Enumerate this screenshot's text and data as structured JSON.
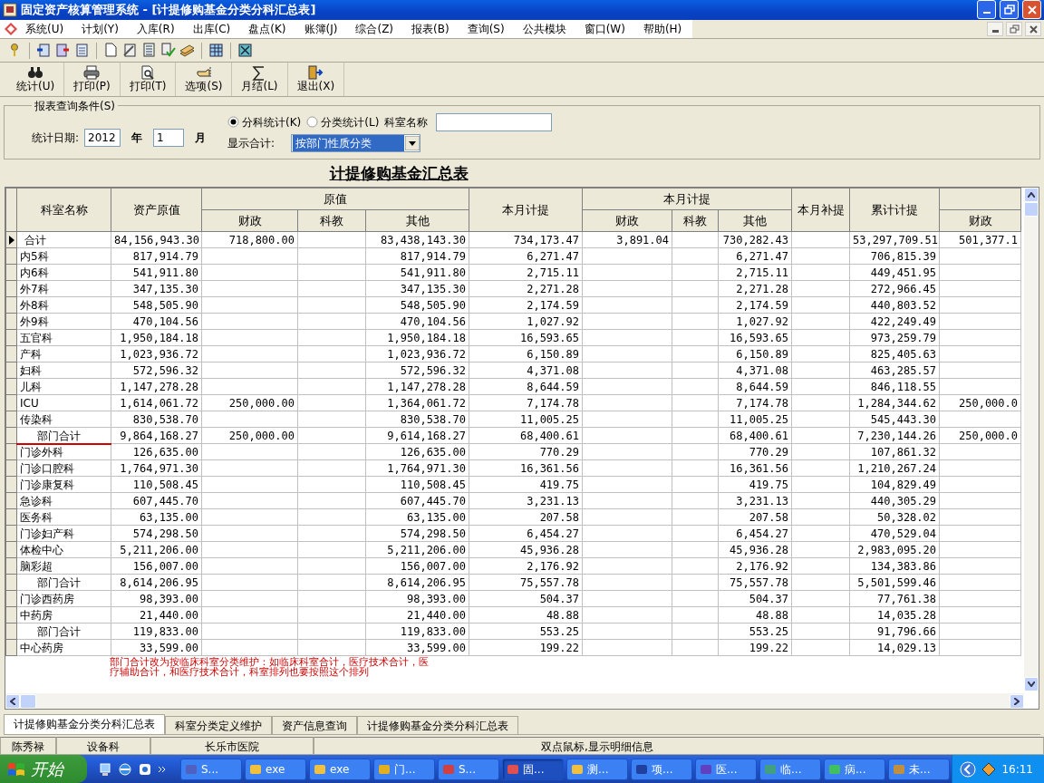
{
  "window": {
    "title": "固定资产核算管理系统 - [计提修购基金分类分科汇总表]"
  },
  "menu": [
    {
      "label": "系统(U)"
    },
    {
      "label": "计划(Y)"
    },
    {
      "label": "入库(R)"
    },
    {
      "label": "出库(C)"
    },
    {
      "label": "盘点(K)"
    },
    {
      "label": "账簿(J)"
    },
    {
      "label": "综合(Z)"
    },
    {
      "label": "报表(B)"
    },
    {
      "label": "查询(S)"
    },
    {
      "label": "公共模块"
    },
    {
      "label": "窗口(W)"
    },
    {
      "label": "帮助(H)"
    }
  ],
  "toolbar_buttons": [
    {
      "label": "统计(U)",
      "kind": "binoculars"
    },
    {
      "label": "打印(P)",
      "kind": "printer"
    },
    {
      "label": "打印(T)",
      "kind": "preview"
    },
    {
      "label": "选项(S)",
      "kind": "pointer"
    },
    {
      "label": "月结(L)",
      "kind": "sigma"
    },
    {
      "label": "退出(X)",
      "kind": "exit"
    }
  ],
  "query": {
    "legend": "报表查询条件(S)",
    "date_label": "统计日期:",
    "year": "2012",
    "year_unit": "年",
    "month": "1",
    "month_unit": "月",
    "radios": [
      {
        "label": "分科统计(K)",
        "selected": true
      },
      {
        "label": "分类统计(L)",
        "selected": false
      }
    ],
    "dept_label": "科室名称",
    "total_label": "显示合计:",
    "total_value": "按部门性质分类"
  },
  "report_title": "计提修购基金汇总表",
  "columns": [
    {
      "label": "科室名称"
    },
    {
      "label": "资产原值"
    },
    {
      "label": "原值",
      "children": [
        {
          "label": "财政"
        },
        {
          "label": "科教"
        },
        {
          "label": "其他"
        }
      ]
    },
    {
      "label": "本月计提"
    },
    {
      "label": "本月计提",
      "children": [
        {
          "label": "财政"
        },
        {
          "label": "科教"
        },
        {
          "label": "其他"
        }
      ]
    },
    {
      "label": "本月补提"
    },
    {
      "label": "累计计提"
    },
    {
      "children": [
        {
          "label": "财政"
        }
      ]
    }
  ],
  "rows": [
    {
      "kind": "total",
      "selected": true,
      "marked": false,
      "cells": [
        "合计",
        "84,156,943.30",
        "718,800.00",
        null,
        "83,438,143.30",
        "734,173.47",
        "3,891.04",
        null,
        "730,282.43",
        null,
        "53,297,709.51",
        "501,377.1"
      ]
    },
    {
      "kind": "dept",
      "selected": false,
      "marked": false,
      "cells": [
        "内5科",
        "817,914.79",
        null,
        null,
        "817,914.79",
        "6,271.47",
        null,
        null,
        "6,271.47",
        null,
        "706,815.39",
        null
      ]
    },
    {
      "kind": "dept",
      "selected": false,
      "marked": false,
      "cells": [
        "内6科",
        "541,911.80",
        null,
        null,
        "541,911.80",
        "2,715.11",
        null,
        null,
        "2,715.11",
        null,
        "449,451.95",
        null
      ]
    },
    {
      "kind": "dept",
      "selected": false,
      "marked": false,
      "cells": [
        "外7科",
        "347,135.30",
        null,
        null,
        "347,135.30",
        "2,271.28",
        null,
        null,
        "2,271.28",
        null,
        "272,966.45",
        null
      ]
    },
    {
      "kind": "dept",
      "selected": false,
      "marked": false,
      "cells": [
        "外8科",
        "548,505.90",
        null,
        null,
        "548,505.90",
        "2,174.59",
        null,
        null,
        "2,174.59",
        null,
        "440,803.52",
        null
      ]
    },
    {
      "kind": "dept",
      "selected": false,
      "marked": false,
      "cells": [
        "外9科",
        "470,104.56",
        null,
        null,
        "470,104.56",
        "1,027.92",
        null,
        null,
        "1,027.92",
        null,
        "422,249.49",
        null
      ]
    },
    {
      "kind": "dept",
      "selected": false,
      "marked": false,
      "cells": [
        "五官科",
        "1,950,184.18",
        null,
        null,
        "1,950,184.18",
        "16,593.65",
        null,
        null,
        "16,593.65",
        null,
        "973,259.79",
        null
      ]
    },
    {
      "kind": "dept",
      "selected": false,
      "marked": false,
      "cells": [
        "产科",
        "1,023,936.72",
        null,
        null,
        "1,023,936.72",
        "6,150.89",
        null,
        null,
        "6,150.89",
        null,
        "825,405.63",
        null
      ]
    },
    {
      "kind": "dept",
      "selected": false,
      "marked": false,
      "cells": [
        "妇科",
        "572,596.32",
        null,
        null,
        "572,596.32",
        "4,371.08",
        null,
        null,
        "4,371.08",
        null,
        "463,285.57",
        null
      ]
    },
    {
      "kind": "dept",
      "selected": false,
      "marked": false,
      "cells": [
        "儿科",
        "1,147,278.28",
        null,
        null,
        "1,147,278.28",
        "8,644.59",
        null,
        null,
        "8,644.59",
        null,
        "846,118.55",
        null
      ]
    },
    {
      "kind": "dept",
      "selected": false,
      "marked": false,
      "cells": [
        "ICU",
        "1,614,061.72",
        "250,000.00",
        null,
        "1,364,061.72",
        "7,174.78",
        null,
        null,
        "7,174.78",
        null,
        "1,284,344.62",
        "250,000.0"
      ]
    },
    {
      "kind": "dept",
      "selected": false,
      "marked": false,
      "cells": [
        "传染科",
        "830,538.70",
        null,
        null,
        "830,538.70",
        "11,005.25",
        null,
        null,
        "11,005.25",
        null,
        "545,443.30",
        null
      ]
    },
    {
      "kind": "subtotal",
      "selected": false,
      "marked": true,
      "cells": [
        "部门合计",
        "9,864,168.27",
        "250,000.00",
        null,
        "9,614,168.27",
        "68,400.61",
        null,
        null,
        "68,400.61",
        null,
        "7,230,144.26",
        "250,000.0"
      ]
    },
    {
      "kind": "dept",
      "selected": false,
      "marked": false,
      "cells": [
        "门诊外科",
        "126,635.00",
        null,
        null,
        "126,635.00",
        "770.29",
        null,
        null,
        "770.29",
        null,
        "107,861.32",
        null
      ]
    },
    {
      "kind": "dept",
      "selected": false,
      "marked": false,
      "cells": [
        "门诊口腔科",
        "1,764,971.30",
        null,
        null,
        "1,764,971.30",
        "16,361.56",
        null,
        null,
        "16,361.56",
        null,
        "1,210,267.24",
        null
      ]
    },
    {
      "kind": "dept",
      "selected": false,
      "marked": false,
      "cells": [
        "门诊康复科",
        "110,508.45",
        null,
        null,
        "110,508.45",
        "419.75",
        null,
        null,
        "419.75",
        null,
        "104,829.49",
        null
      ]
    },
    {
      "kind": "dept",
      "selected": false,
      "marked": false,
      "cells": [
        "急诊科",
        "607,445.70",
        null,
        null,
        "607,445.70",
        "3,231.13",
        null,
        null,
        "3,231.13",
        null,
        "440,305.29",
        null
      ]
    },
    {
      "kind": "dept",
      "selected": false,
      "marked": false,
      "cells": [
        "医务科",
        "63,135.00",
        null,
        null,
        "63,135.00",
        "207.58",
        null,
        null,
        "207.58",
        null,
        "50,328.02",
        null
      ]
    },
    {
      "kind": "dept",
      "selected": false,
      "marked": false,
      "cells": [
        "门诊妇产科",
        "574,298.50",
        null,
        null,
        "574,298.50",
        "6,454.27",
        null,
        null,
        "6,454.27",
        null,
        "470,529.04",
        null
      ]
    },
    {
      "kind": "dept",
      "selected": false,
      "marked": false,
      "cells": [
        "体检中心",
        "5,211,206.00",
        null,
        null,
        "5,211,206.00",
        "45,936.28",
        null,
        null,
        "45,936.28",
        null,
        "2,983,095.20",
        null
      ]
    },
    {
      "kind": "dept",
      "selected": false,
      "marked": false,
      "cells": [
        "脑彩超",
        "156,007.00",
        null,
        null,
        "156,007.00",
        "2,176.92",
        null,
        null,
        "2,176.92",
        null,
        "134,383.86",
        null
      ]
    },
    {
      "kind": "subtotal",
      "selected": false,
      "marked": false,
      "cells": [
        "部门合计",
        "8,614,206.95",
        null,
        null,
        "8,614,206.95",
        "75,557.78",
        null,
        null,
        "75,557.78",
        null,
        "5,501,599.46",
        null
      ]
    },
    {
      "kind": "dept",
      "selected": false,
      "marked": false,
      "cells": [
        "门诊西药房",
        "98,393.00",
        null,
        null,
        "98,393.00",
        "504.37",
        null,
        null,
        "504.37",
        null,
        "77,761.38",
        null
      ]
    },
    {
      "kind": "dept",
      "selected": false,
      "marked": false,
      "cells": [
        "中药房",
        "21,440.00",
        null,
        null,
        "21,440.00",
        "48.88",
        null,
        null,
        "48.88",
        null,
        "14,035.28",
        null
      ]
    },
    {
      "kind": "subtotal",
      "selected": false,
      "marked": false,
      "cells": [
        "部门合计",
        "119,833.00",
        null,
        null,
        "119,833.00",
        "553.25",
        null,
        null,
        "553.25",
        null,
        "91,796.66",
        null
      ]
    },
    {
      "kind": "dept",
      "selected": false,
      "marked": false,
      "cells": [
        "中心药房",
        "33,599.00",
        null,
        null,
        "33,599.00",
        "199.22",
        null,
        null,
        "199.22",
        null,
        "14,029.13",
        null
      ]
    }
  ],
  "note": "部门合计改为按临床科室分类维护：如临床科室合计，医疗技术合计，医疗辅助合计，和医疗技术合计，科室排列也要按照这个排列",
  "tabs": [
    {
      "label": "计提修购基金分类分科汇总表",
      "selected": true
    },
    {
      "label": "科室分类定义维护",
      "selected": false
    },
    {
      "label": "资产信息查询",
      "selected": false
    },
    {
      "label": "计提修购基金分类分科汇总表",
      "selected": false
    }
  ],
  "status_bar": [
    "陈秀禄",
    "设备科",
    "长乐市医院",
    "双点鼠标,显示明细信息"
  ],
  "taskbar": {
    "start": "开始",
    "tasks": [
      {
        "label": "S...",
        "selected": false
      },
      {
        "label": "exe",
        "selected": false
      },
      {
        "label": "exe",
        "selected": false
      },
      {
        "label": "门...",
        "selected": false
      },
      {
        "label": "S...",
        "selected": false
      },
      {
        "label": "固...",
        "selected": true
      },
      {
        "label": "测...",
        "selected": false
      },
      {
        "label": "项...",
        "selected": false
      },
      {
        "label": "医...",
        "selected": false
      },
      {
        "label": "临...",
        "selected": false
      },
      {
        "label": "病...",
        "selected": false
      },
      {
        "label": "未...",
        "selected": false
      }
    ],
    "clock": "16:11"
  }
}
